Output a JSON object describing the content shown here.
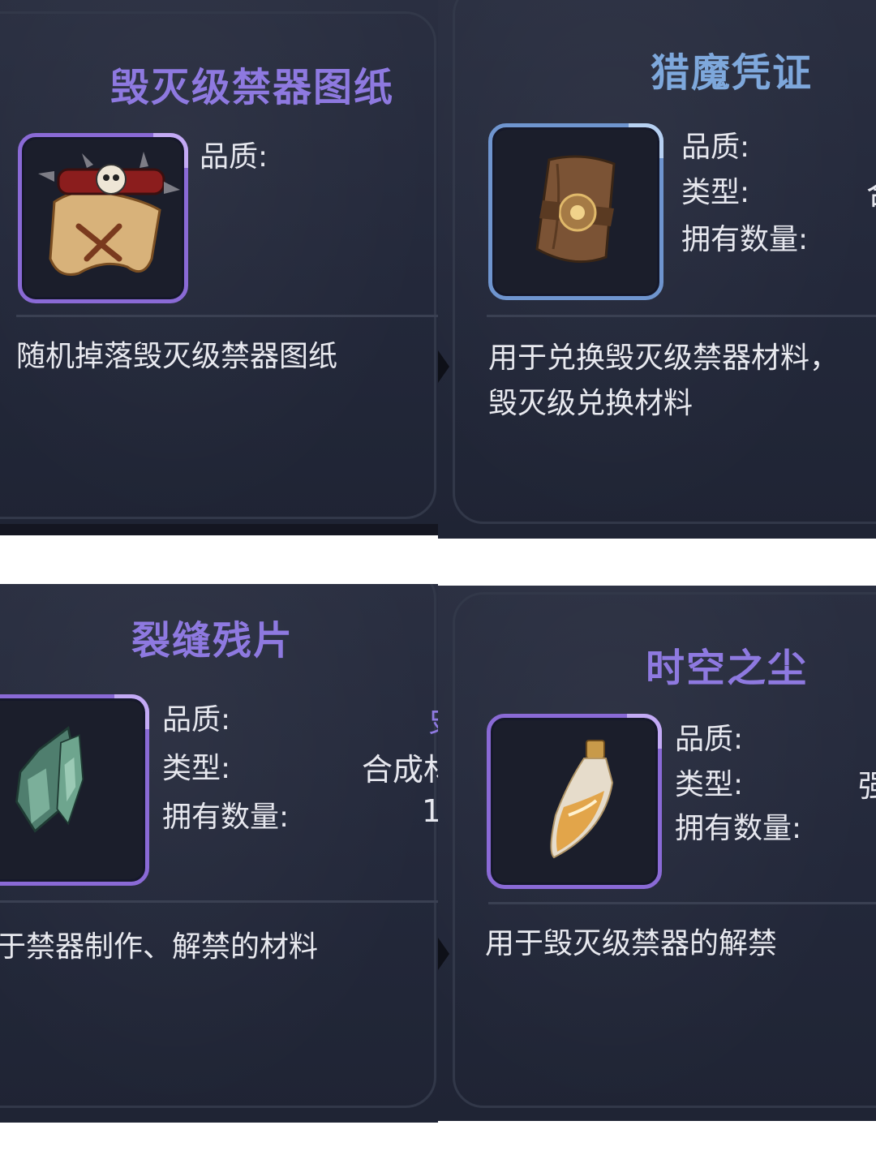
{
  "labels": {
    "quality": "品质:",
    "type": "类型:",
    "owned": "拥有数量:"
  },
  "panels": [
    {
      "title": "毁灭级禁器图纸",
      "description": [
        "随机掉落毁灭级禁器图纸"
      ],
      "frame_color": "#8a6ad6",
      "icon": "cursed-blueprint-scroll-icon"
    },
    {
      "title": "猎魔凭证",
      "type_value_partial": "合",
      "description": [
        "用于兑换毁灭级禁器材料，",
        "毁灭级兑换材料"
      ],
      "frame_color": "#6f95cf",
      "icon": "rolled-scroll-icon"
    },
    {
      "title": "裂缝残片",
      "quality_value_partial": "史",
      "type_value_partial": "合成材",
      "owned_value_partial": "1",
      "description": [
        "于禁器制作、解禁的材料"
      ],
      "frame_color": "#8a6ad6",
      "icon": "crystal-shard-icon"
    },
    {
      "title": "时空之尘",
      "type_value_partial": "强",
      "description": [
        "用于毁灭级禁器的解禁"
      ],
      "frame_color": "#8a6ad6",
      "icon": "dust-vial-icon"
    }
  ],
  "colors": {
    "title_purple": "#8e79e0",
    "title_blue": "#7ea8dc",
    "panel_bg": "#252a3a",
    "text": "#e6e7ee"
  }
}
